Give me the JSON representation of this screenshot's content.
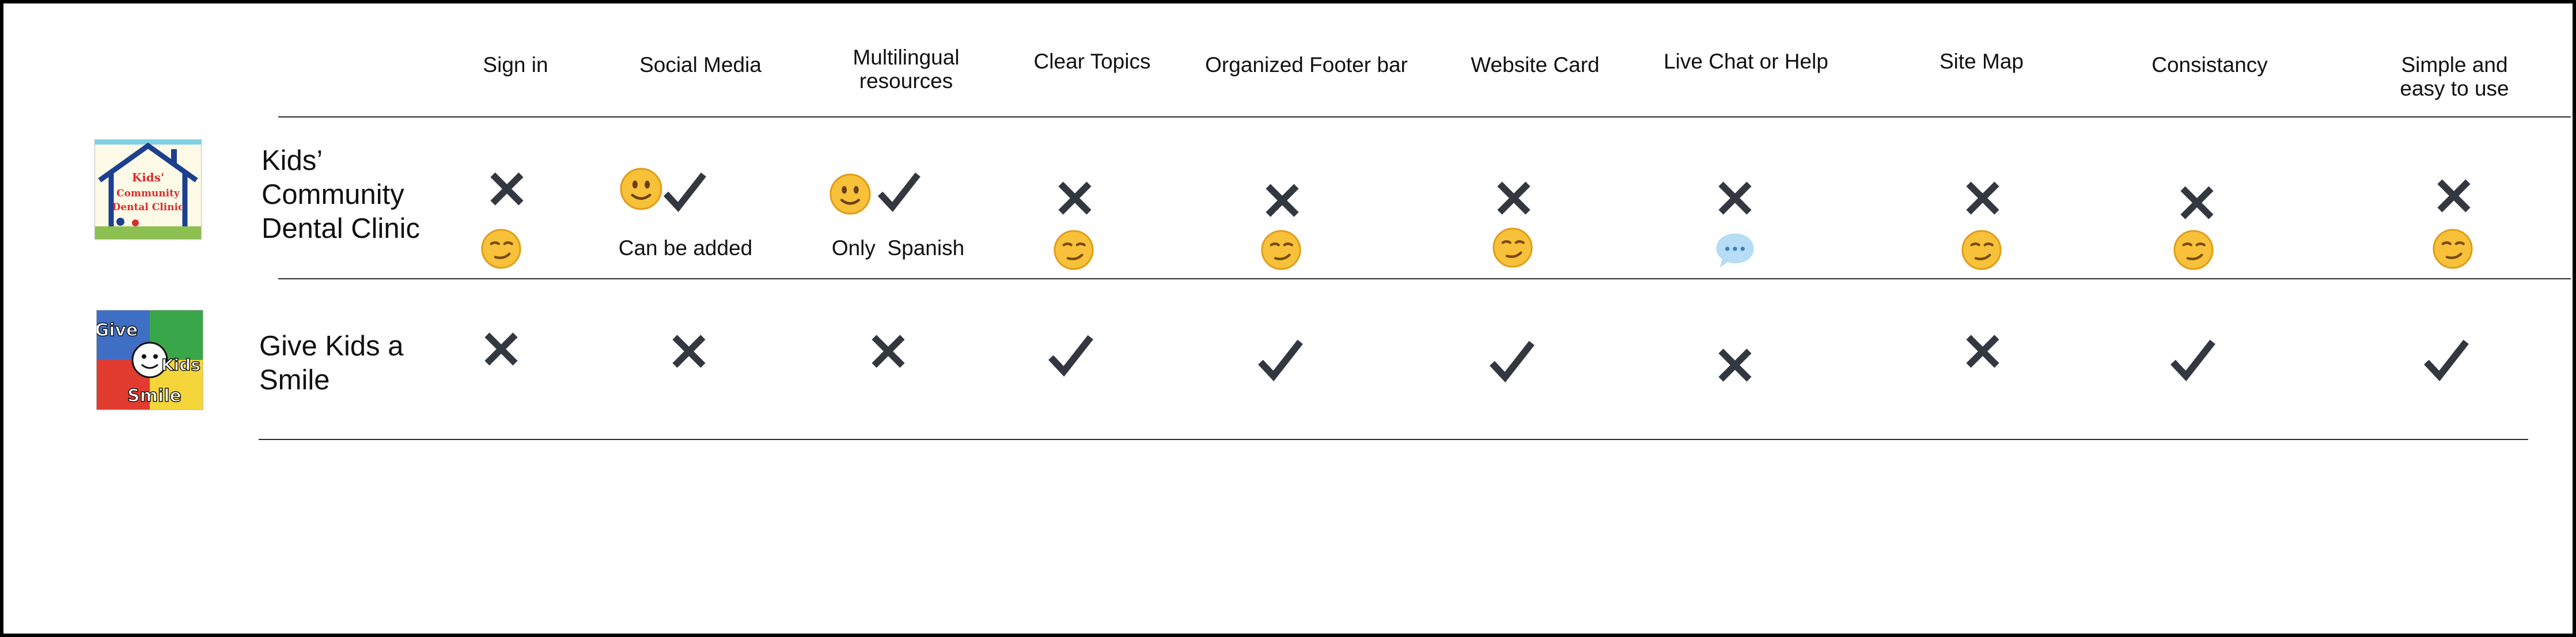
{
  "columns": [
    {
      "key": "sign-in",
      "label": "Sign in"
    },
    {
      "key": "social-media",
      "label": "Social Media"
    },
    {
      "key": "multilingual",
      "label": "Multilingual\nresources"
    },
    {
      "key": "clear-topics",
      "label": "Clear Topics"
    },
    {
      "key": "footer-bar",
      "label": "Organized Footer bar"
    },
    {
      "key": "website-card",
      "label": "Website Card"
    },
    {
      "key": "live-chat",
      "label": "Live Chat or Help"
    },
    {
      "key": "site-map",
      "label": "Site Map"
    },
    {
      "key": "consistancy",
      "label": "Consistancy"
    },
    {
      "key": "simple",
      "label": "Simple and easy to use"
    }
  ],
  "rows": [
    {
      "name": "Kids’\nCommunity\nDental Clinic",
      "logo": {
        "lines": [
          "Kids'",
          "Community",
          "Dental Clinic"
        ],
        "icon": "house-logo"
      },
      "cells": [
        {
          "mark": "cross",
          "emoji": "smirk"
        },
        {
          "mark": "check",
          "emoji": "smile",
          "note": "Can be added"
        },
        {
          "mark": "check",
          "emoji": "smile",
          "note": "Only  Spanish"
        },
        {
          "mark": "cross",
          "emoji": "smirk"
        },
        {
          "mark": "cross",
          "emoji": "smirk"
        },
        {
          "mark": "cross",
          "emoji": "smirk"
        },
        {
          "mark": "cross",
          "emoji": "speech-balloon"
        },
        {
          "mark": "cross",
          "emoji": "smirk"
        },
        {
          "mark": "cross",
          "emoji": "smirk"
        },
        {
          "mark": "cross",
          "emoji": "smirk"
        }
      ]
    },
    {
      "name": "Give Kids a\nSmile",
      "logo": {
        "lines": [
          "Give",
          "Kids",
          "Smile"
        ],
        "icon": "cartoon-logo"
      },
      "cells": [
        {
          "mark": "cross"
        },
        {
          "mark": "cross"
        },
        {
          "mark": "cross"
        },
        {
          "mark": "check"
        },
        {
          "mark": "check"
        },
        {
          "mark": "check"
        },
        {
          "mark": "cross"
        },
        {
          "mark": "cross"
        },
        {
          "mark": "check"
        },
        {
          "mark": "check"
        }
      ]
    }
  ],
  "colors": {
    "mark": "#333740",
    "emoji_face": "#f7c13a",
    "emoji_outline": "#e29b18",
    "speech_balloon": "#b6dcf6",
    "frame": "#000000",
    "rule": "#2b2b2b"
  }
}
